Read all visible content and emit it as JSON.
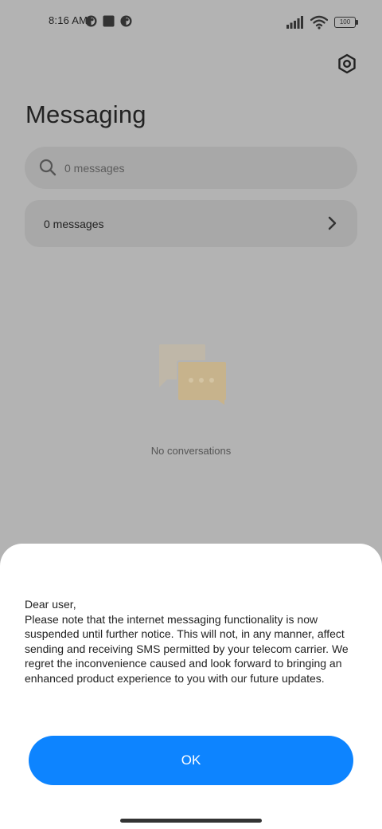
{
  "status_bar": {
    "time": "8:16 AM",
    "battery": "100",
    "icons": [
      "notification-dot-icon",
      "square-notification-icon",
      "notification-dot-icon",
      "signal-icon",
      "wifi-icon",
      "battery-icon"
    ]
  },
  "header": {
    "title": "Messaging",
    "settings_icon": "settings-hex-icon"
  },
  "search": {
    "placeholder": "0 messages",
    "icon": "search-icon"
  },
  "messages_row": {
    "label": "0 messages",
    "icon": "chevron-right-icon"
  },
  "empty_state": {
    "text": "No conversations",
    "icon": "chat-bubbles-icon"
  },
  "dialog": {
    "greeting": "Dear user,",
    "body": "Please note that the internet messaging functionality is now suspended until further notice. This will not, in any manner, affect sending and receiving SMS permitted by your telecom carrier. We regret the inconvenience caused and look forward to bringing an enhanced product experience to you with our future updates.",
    "ok_label": "OK"
  },
  "colors": {
    "background_dim": "#b3b3b3",
    "card": "#a8a8a8",
    "accent": "#0d84ff",
    "sheet": "#ffffff"
  }
}
